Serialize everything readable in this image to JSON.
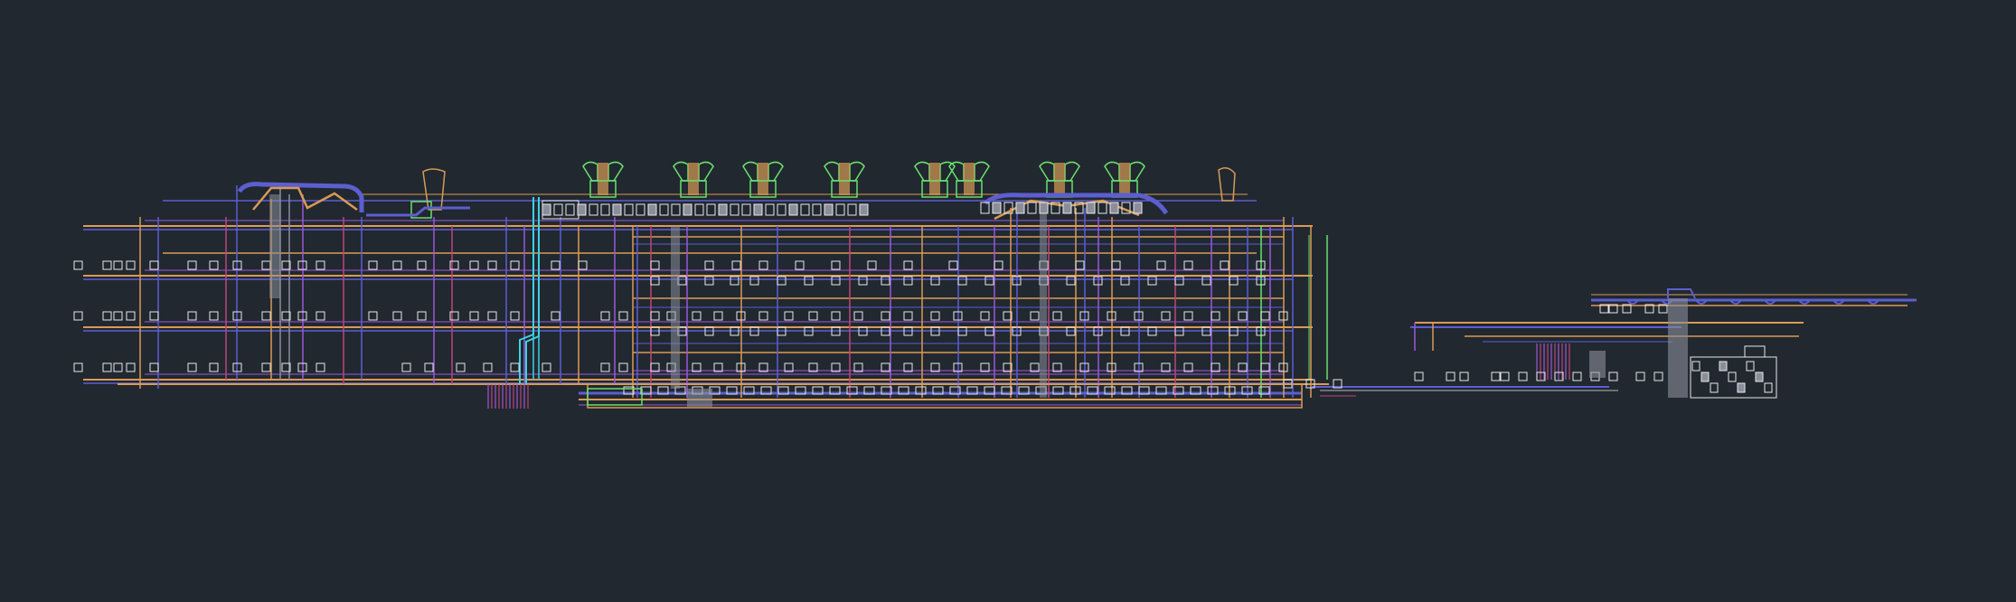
{
  "viewport": {
    "background": "#212830"
  },
  "layers": [
    {
      "name": "duct-orange",
      "color": "#d99a55"
    },
    {
      "name": "pipe-blue",
      "color": "#5d5ecf"
    },
    {
      "name": "pipe-violet",
      "color": "#9b59d6"
    },
    {
      "name": "pipe-magenta",
      "color": "#c0447a"
    },
    {
      "name": "pipe-cyan",
      "color": "#3fd1e3"
    },
    {
      "name": "equipment-green",
      "color": "#69e06c"
    },
    {
      "name": "fixture-white",
      "color": "#e8e8e8"
    },
    {
      "name": "fill-grey",
      "color": "#8b8e9a"
    }
  ]
}
